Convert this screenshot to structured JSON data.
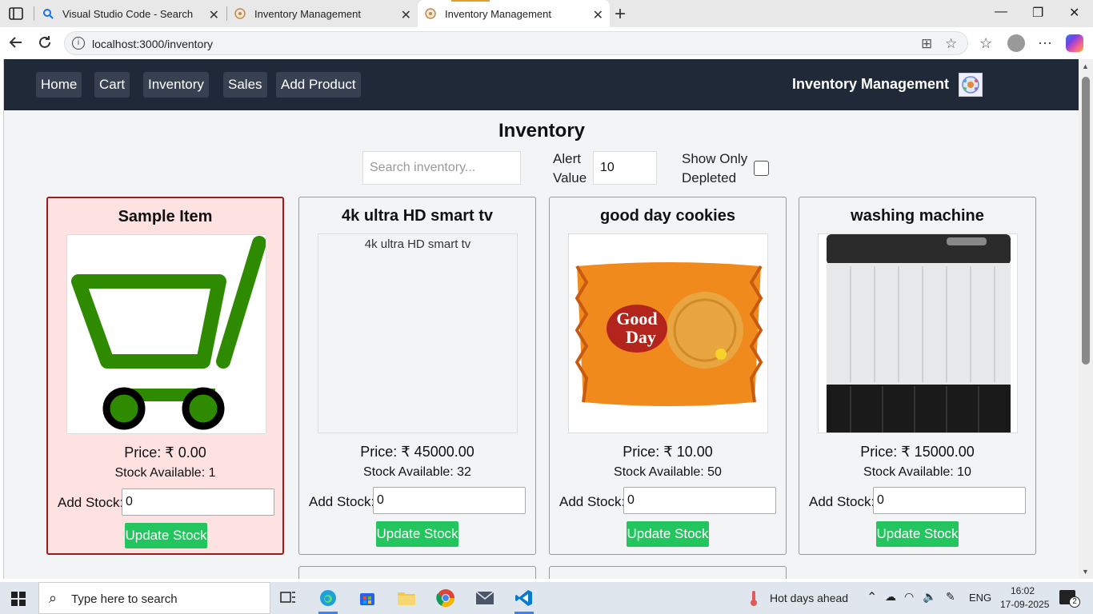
{
  "browser": {
    "tabs": [
      {
        "title": "Visual Studio Code - Search"
      },
      {
        "title": "Inventory Management"
      },
      {
        "title": "Inventory Management"
      }
    ],
    "url": "localhost:3000/inventory"
  },
  "navbar": {
    "links": [
      "Home",
      "Cart",
      "Inventory",
      "Sales",
      "Add Product"
    ],
    "brand": "Inventory Management"
  },
  "page": {
    "title": "Inventory",
    "search_placeholder": "Search inventory...",
    "alert_label": "Alert Value",
    "alert_value": "10",
    "depleted_label": "Show Only Depleted"
  },
  "products": [
    {
      "name": "Sample Item",
      "price": "Price: ₹ 0.00",
      "stock": "Stock Available: 1",
      "add_label": "Add Stock:",
      "add_value": "0",
      "button": "Update Stock",
      "depleted": true,
      "image": "cart-icon"
    },
    {
      "name": "4k ultra HD smart tv",
      "price": "Price: ₹ 45000.00",
      "stock": "Stock Available: 32",
      "add_label": "Add Stock:",
      "add_value": "0",
      "button": "Update Stock",
      "depleted": false,
      "image_alt": "4k ultra HD smart tv"
    },
    {
      "name": "good day cookies",
      "price": "Price: ₹ 10.00",
      "stock": "Stock Available: 50",
      "add_label": "Add Stock:",
      "add_value": "0",
      "button": "Update Stock",
      "depleted": false,
      "image": "biscuit-pack"
    },
    {
      "name": "washing machine",
      "price": "Price: ₹ 15000.00",
      "stock": "Stock Available: 10",
      "add_label": "Add Stock:",
      "add_value": "0",
      "button": "Update Stock",
      "depleted": false,
      "image": "washing-machine"
    }
  ],
  "taskbar": {
    "search_text": "Type here to search",
    "weather": "Hot days ahead",
    "lang": "ENG",
    "time": "16:02",
    "date": "17-09-2025",
    "notifications": "2"
  },
  "colors": {
    "navbar": "#1f2937",
    "button": "#22c55e",
    "depleted_bg": "#fee2e2",
    "depleted_border": "#9b1c1c"
  }
}
